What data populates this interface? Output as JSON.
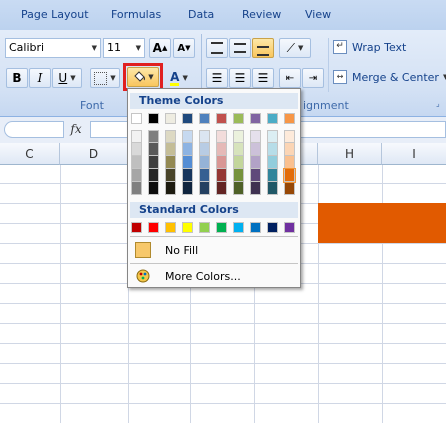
{
  "tabs": [
    "Page Layout",
    "Formulas",
    "Data",
    "Review",
    "View"
  ],
  "font": {
    "name": "Calibri",
    "size": "11",
    "grow_label": "A",
    "shrink_label": "A",
    "bold": "B",
    "italic": "I",
    "underline": "U",
    "font_color_label": "A",
    "group_label": "Font"
  },
  "alignment": {
    "wrap_text": "Wrap Text",
    "merge_center": "Merge & Center",
    "group_label": "ignment"
  },
  "formula_bar": {
    "fx": "fx"
  },
  "columns": [
    "C",
    "D",
    "H",
    "I"
  ],
  "colors": {
    "highlight": "#e15a00",
    "selection_outline": "#e02020",
    "no_fill_swatch": "#f7c86b"
  },
  "palette": {
    "theme_title": "Theme Colors",
    "standard_title": "Standard Colors",
    "no_fill": "No Fill",
    "more_colors": "More Colors...",
    "theme_top": [
      "#ffffff",
      "#000000",
      "#eeece1",
      "#1f497d",
      "#4f81bd",
      "#c0504d",
      "#9bbb59",
      "#8064a2",
      "#4bacc6",
      "#f79646"
    ],
    "theme_shades": [
      [
        "#f2f2f2",
        "#d9d9d9",
        "#bfbfbf",
        "#a6a6a6",
        "#808080"
      ],
      [
        "#7f7f7f",
        "#595959",
        "#3f3f3f",
        "#262626",
        "#0d0d0d"
      ],
      [
        "#ddd9c3",
        "#c4bd97",
        "#938953",
        "#494429",
        "#1d1b10"
      ],
      [
        "#c6d9f0",
        "#8db3e2",
        "#548dd4",
        "#17365d",
        "#0f243e"
      ],
      [
        "#dbe5f1",
        "#b8cce4",
        "#95b3d7",
        "#366092",
        "#244061"
      ],
      [
        "#f2dcdb",
        "#e5b9b7",
        "#d99694",
        "#953734",
        "#632423"
      ],
      [
        "#ebf1dd",
        "#d7e3bc",
        "#c3d69b",
        "#76923c",
        "#4f6128"
      ],
      [
        "#e5e0ec",
        "#ccc1d9",
        "#b2a2c7",
        "#5f497a",
        "#3f3151"
      ],
      [
        "#dbeef3",
        "#b7dde8",
        "#92cddc",
        "#31859b",
        "#205867"
      ],
      [
        "#fdeada",
        "#fbd5b5",
        "#fac08f",
        "#e36c09",
        "#974806"
      ]
    ],
    "standard": [
      "#c00000",
      "#ff0000",
      "#ffc000",
      "#ffff00",
      "#92d050",
      "#00b050",
      "#00b0f0",
      "#0070c0",
      "#002060",
      "#7030a0"
    ]
  },
  "icons": {
    "fill_bucket": "paint-bucket-icon",
    "more_colors": "color-wheel-icon"
  }
}
